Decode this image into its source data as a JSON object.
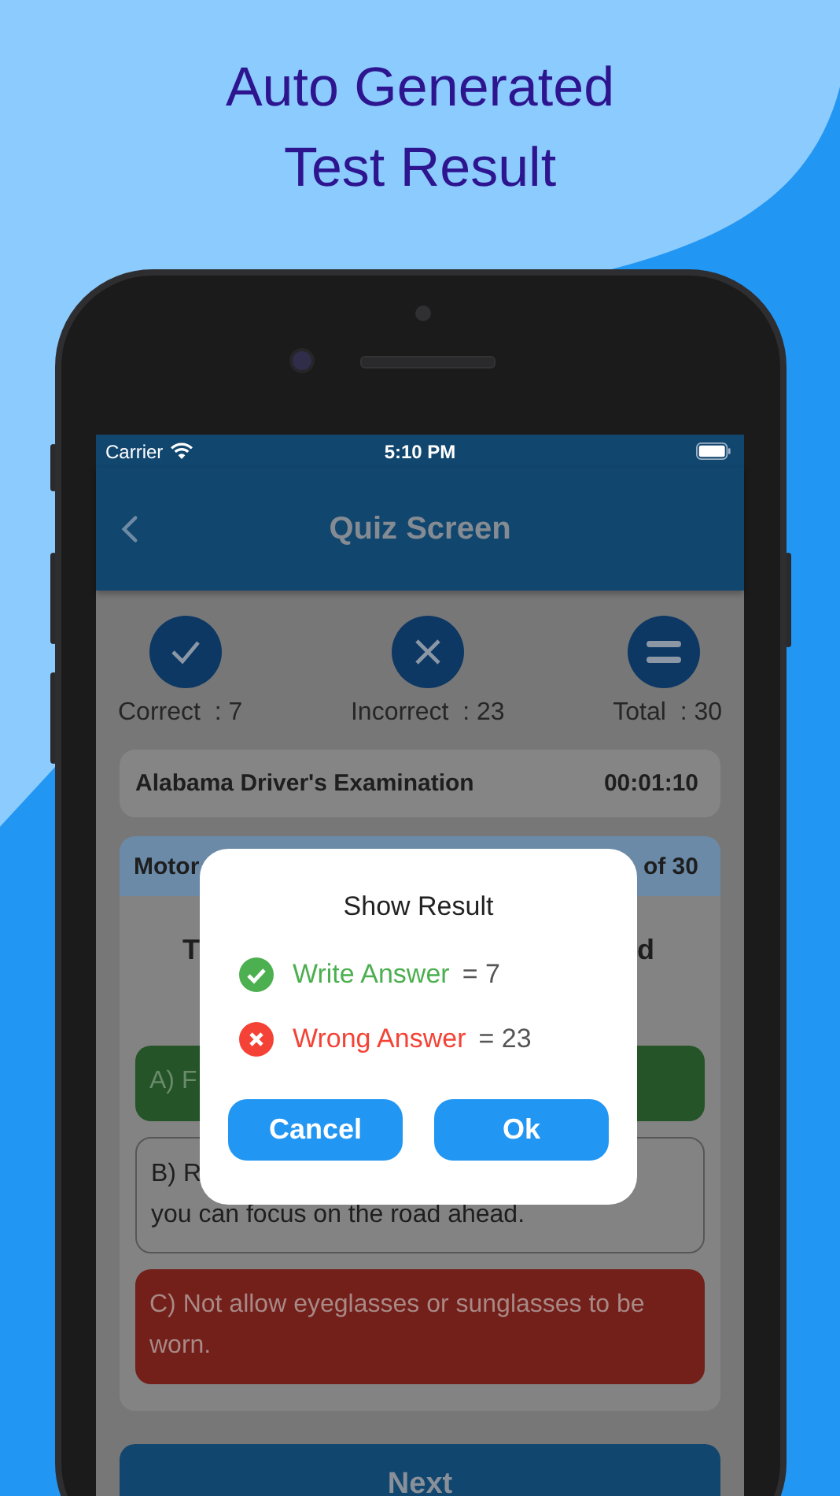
{
  "headline": [
    "Auto Generated",
    "Test Result"
  ],
  "status_bar": {
    "carrier": "Carrier",
    "time": "5:10 PM"
  },
  "app_bar": {
    "title": "Quiz Screen"
  },
  "stats": [
    {
      "kind": "correct",
      "label": "Correct  : 7"
    },
    {
      "kind": "incorrect",
      "label": "Incorrect  : 23"
    },
    {
      "kind": "total",
      "label": "Total  : 30"
    }
  ],
  "exam": {
    "name": "Alabama Driver's Examination",
    "timer": "00:01:10"
  },
  "question_card": {
    "header_left": "Motor",
    "header_right": "of 30",
    "question_left": "T",
    "question_right": "d",
    "options": [
      {
        "kind": "correct",
        "lines": [
          "A) F"
        ]
      },
      {
        "kind": "neutral",
        "lines": [
          "B) R",
          "you can focus on the road ahead."
        ]
      },
      {
        "kind": "wrong",
        "lines": [
          "C) Not allow eyeglasses or sunglasses to be worn."
        ]
      }
    ]
  },
  "next_button": "Next",
  "dialog": {
    "title": "Show Result",
    "rows": [
      {
        "kind": "right",
        "label": "Write Answer",
        "value": "= 7"
      },
      {
        "kind": "wrong",
        "label": "Wrong Answer",
        "value": "= 23"
      }
    ],
    "buttons": [
      "Cancel",
      "Ok"
    ]
  }
}
